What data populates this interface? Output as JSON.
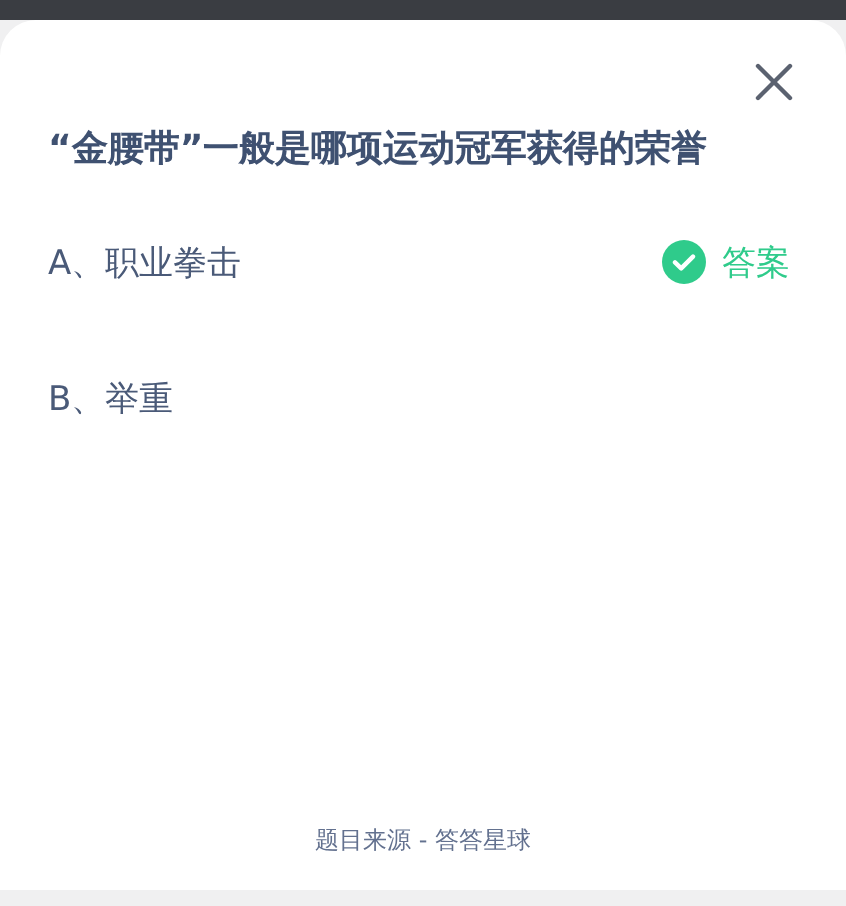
{
  "question": "“金腰带”一般是哪项运动冠军获得的荣誉",
  "options": [
    {
      "label": "A、职业拳击",
      "correct": true
    },
    {
      "label": "B、举重",
      "correct": false
    }
  ],
  "answer_label": "答案",
  "source": "题目来源 - 答答星球"
}
